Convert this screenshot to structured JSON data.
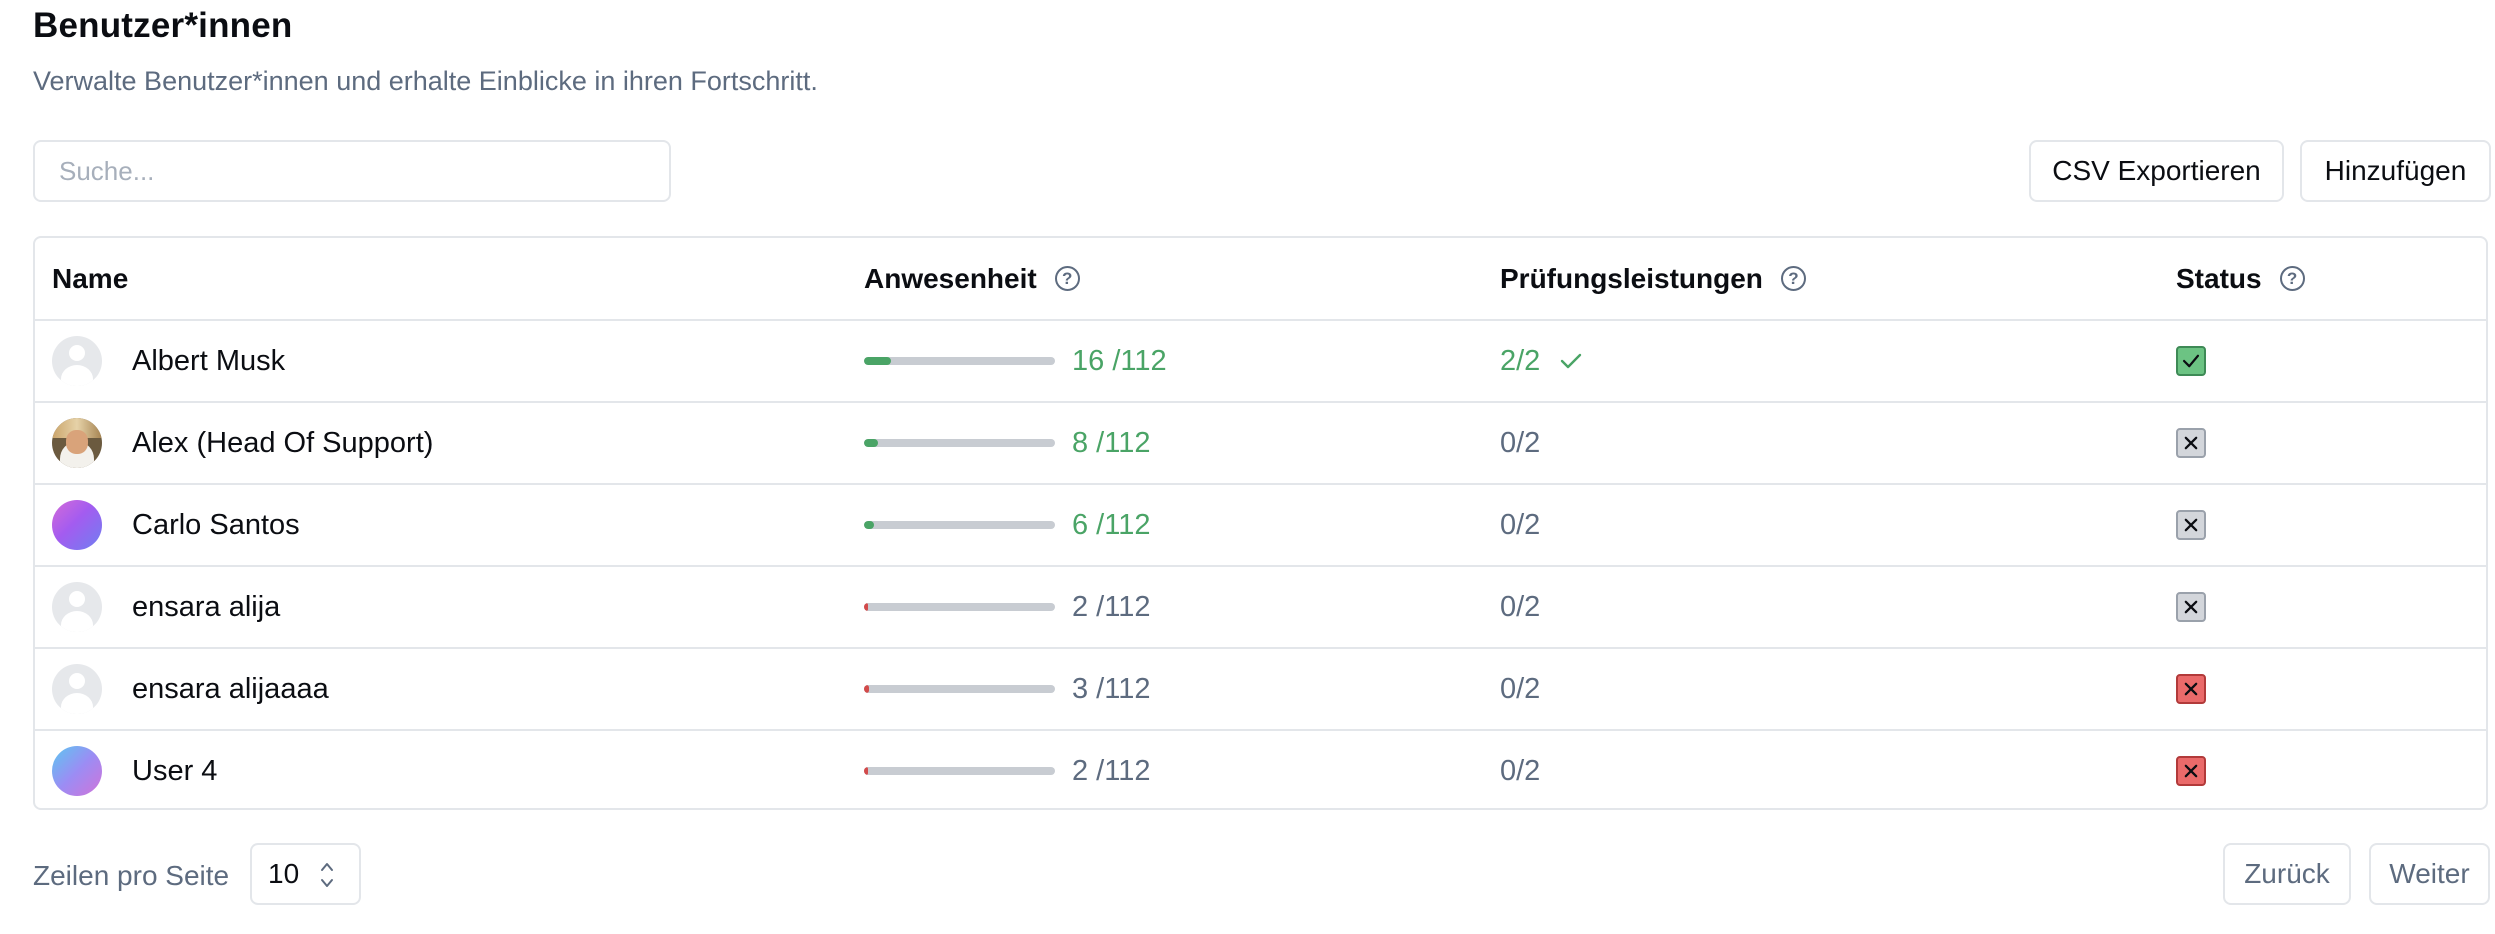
{
  "header": {
    "title": "Benutzer*innen",
    "subtitle": "Verwalte Benutzer*innen und erhalte Einblicke in ihren Fortschritt."
  },
  "toolbar": {
    "search_placeholder": "Suche...",
    "search_value": "",
    "export_label": "CSV Exportieren",
    "add_label": "Hinzufügen"
  },
  "table": {
    "columns": {
      "name": "Name",
      "attendance": "Anwesenheit",
      "exam": "Prüfungsleistungen",
      "status": "Status",
      "help_glyph": "?"
    },
    "rows": [
      {
        "name": "Albert Musk",
        "avatar": "placeholder-avatar-icon",
        "attendance_text": "16 /112",
        "attendance": 16,
        "attendance_total": 112,
        "exam_text": "2/2",
        "exam_passed": true,
        "status": "checked"
      },
      {
        "name": "Alex (Head Of Support)",
        "avatar": "photo-avatar",
        "attendance_text": "8 /112",
        "attendance": 8,
        "attendance_total": 112,
        "exam_text": "0/2",
        "exam_passed": false,
        "status": "failed-gray"
      },
      {
        "name": "Carlo Santos",
        "avatar": "gradient-avatar-pink",
        "attendance_text": "6 /112",
        "attendance": 6,
        "attendance_total": 112,
        "exam_text": "0/2",
        "exam_passed": false,
        "status": "failed-gray"
      },
      {
        "name": "ensara alija",
        "avatar": "placeholder-avatar-icon",
        "attendance_text": "2 /112",
        "attendance": 2,
        "attendance_total": 112,
        "exam_text": "0/2",
        "exam_passed": false,
        "status": "failed-gray"
      },
      {
        "name": "ensara alijaaaa",
        "avatar": "placeholder-avatar-icon",
        "attendance_text": "3 /112",
        "attendance": 3,
        "attendance_total": 112,
        "exam_text": "0/2",
        "exam_passed": false,
        "status": "failed-red"
      },
      {
        "name": "User 4",
        "avatar": "gradient-avatar-blue",
        "attendance_text": "2 /112",
        "attendance": 2,
        "attendance_total": 112,
        "exam_text": "0/2",
        "exam_passed": false,
        "status": "failed-red"
      }
    ]
  },
  "footer": {
    "rows_per_page_label": "Zeilen pro Seite",
    "rows_per_page_value": "10",
    "back_label": "Zurück",
    "next_label": "Weiter"
  },
  "colors": {
    "good": "#4aa466",
    "neutral": "#5d6b7f",
    "bar_track": "#c8ccd2",
    "bar_good": "#4aa466",
    "bar_bad": "#d24a4a",
    "status_check_bg": "#6cc383",
    "status_gray_bg": "#d3d6db",
    "status_red_bg": "#ea6a6a",
    "border": "#e3e6ea"
  }
}
